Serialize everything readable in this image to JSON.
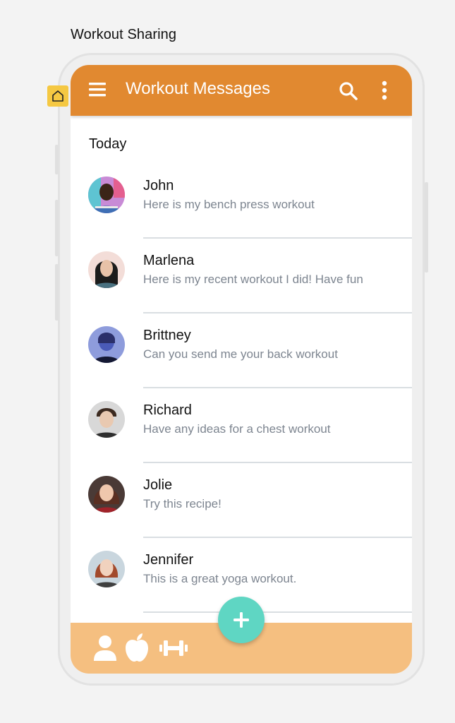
{
  "frame_title": "Workout Sharing",
  "appbar": {
    "title": "Workout Messages",
    "menu_icon": "hamburger-menu-icon",
    "search_icon": "search-icon",
    "more_icon": "more-vertical-icon",
    "color": "#e18930"
  },
  "section": {
    "label": "Today"
  },
  "conversations": [
    {
      "name": "John",
      "preview": "Here is my bench press workout"
    },
    {
      "name": "Marlena",
      "preview": "Here is my recent workout I did! Have fun"
    },
    {
      "name": "Brittney",
      "preview": "Can you send me your back workout"
    },
    {
      "name": "Richard",
      "preview": "Have any ideas for a chest workout"
    },
    {
      "name": "Jolie",
      "preview": "Try this recipe!"
    },
    {
      "name": "Jennifer",
      "preview": "This is a great yoga workout."
    }
  ],
  "fab": {
    "icon": "plus-icon",
    "color": "#5fd6c3"
  },
  "bottom_nav": {
    "color": "#f5bf80",
    "items": [
      {
        "icon": "user-icon"
      },
      {
        "icon": "apple-icon"
      },
      {
        "icon": "dumbbell-icon"
      }
    ]
  }
}
